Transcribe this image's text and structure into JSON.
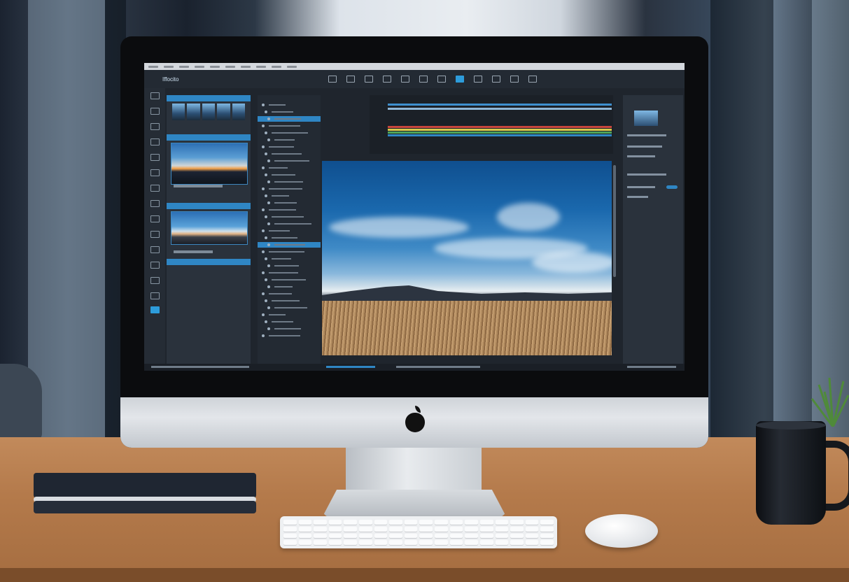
{
  "app": {
    "title": "Iffocito"
  },
  "scene": {
    "objects": [
      "monitor",
      "keyboard",
      "mouse",
      "notebook",
      "mug",
      "plant",
      "desk"
    ]
  },
  "icons": {
    "apple_logo": "apple-logo-icon",
    "tools": [
      "check-icon",
      "brush-icon",
      "move-icon",
      "crop-icon",
      "layer-icon",
      "save-icon",
      "frame-icon",
      "grid-icon",
      "image-icon",
      "pin-icon",
      "window-icon",
      "export-icon"
    ]
  },
  "colors": {
    "accent": "#2d9cdb",
    "panel": "#2a323c",
    "background": "#1f252d"
  }
}
